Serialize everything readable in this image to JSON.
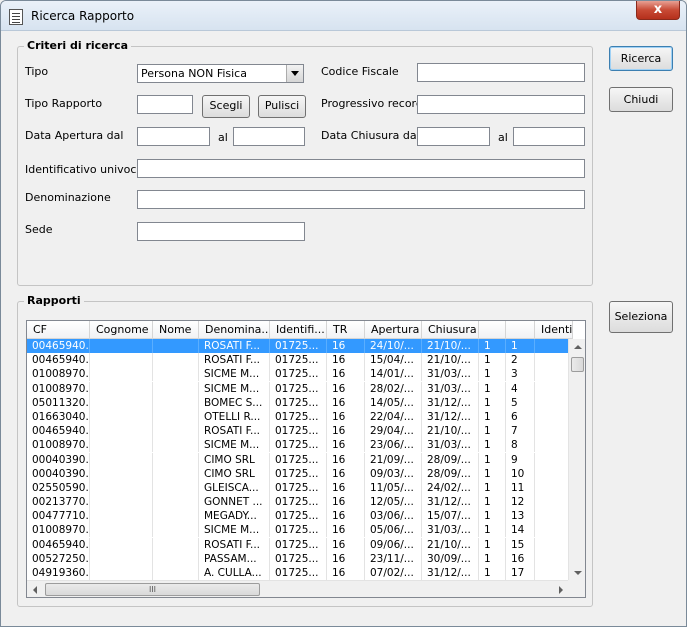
{
  "window": {
    "title": "Ricerca Rapporto",
    "close_glyph": "x"
  },
  "criteria": {
    "group_title": "Criteri di ricerca",
    "tipo_label": "Tipo",
    "tipo_value": "Persona NON Fisica",
    "codice_fiscale_label": "Codice Fiscale",
    "codice_fiscale_value": "",
    "tipo_rapporto_label": "Tipo Rapporto",
    "tipo_rapporto_value": "",
    "scegli_label": "Scegli",
    "pulisci_label": "Pulisci",
    "progressivo_label": "Progressivo record",
    "progressivo_value": "",
    "data_apertura_label": "Data Apertura dal",
    "data_apertura_dal": "",
    "al_label_1": "al",
    "data_apertura_al": "",
    "data_chiusura_label": "Data Chiusura dal",
    "data_chiusura_dal": "",
    "al_label_2": "al",
    "data_chiusura_al": "",
    "identificativo_label": "Identificativo univoco",
    "identificativo_value": "",
    "denominazione_label": "Denominazione",
    "denominazione_value": "",
    "sede_label": "Sede",
    "sede_value": ""
  },
  "buttons": {
    "ricerca": "Ricerca",
    "chiudi": "Chiudi",
    "seleziona": "Seleziona"
  },
  "rapporti": {
    "group_title": "Rapporti",
    "columns": [
      "CF",
      "Cognome",
      "Nome",
      "Denomina...",
      "Identifi...",
      "TR",
      "Apertura",
      "Chiusura",
      "",
      "",
      "Identif"
    ],
    "rows": [
      [
        "00465940...",
        "",
        "",
        "ROSATI F...",
        "01725...",
        "16",
        "24/10/...",
        "21/10/...",
        "1",
        "1"
      ],
      [
        "00465940...",
        "",
        "",
        "ROSATI F...",
        "01725...",
        "16",
        "15/04/...",
        "21/10/...",
        "1",
        "2"
      ],
      [
        "01008970...",
        "",
        "",
        "SICME M...",
        "01725...",
        "16",
        "14/01/...",
        "31/03/...",
        "1",
        "3"
      ],
      [
        "01008970...",
        "",
        "",
        "SICME M...",
        "01725...",
        "16",
        "28/02/...",
        "31/03/...",
        "1",
        "4"
      ],
      [
        "05011320...",
        "",
        "",
        "BOMEC S...",
        "01725...",
        "16",
        "14/05/...",
        "31/12/...",
        "1",
        "5"
      ],
      [
        "01663040...",
        "",
        "",
        "OTELLI R...",
        "01725...",
        "16",
        "22/04/...",
        "31/12/...",
        "1",
        "6"
      ],
      [
        "00465940...",
        "",
        "",
        "ROSATI F...",
        "01725...",
        "16",
        "29/04/...",
        "21/10/...",
        "1",
        "7"
      ],
      [
        "01008970...",
        "",
        "",
        "SICME M...",
        "01725...",
        "16",
        "23/06/...",
        "31/03/...",
        "1",
        "8"
      ],
      [
        "00040390...",
        "",
        "",
        "CIMO SRL",
        "01725...",
        "16",
        "21/09/...",
        "28/09/...",
        "1",
        "9"
      ],
      [
        "00040390...",
        "",
        "",
        "CIMO SRL",
        "01725...",
        "16",
        "09/03/...",
        "28/09/...",
        "1",
        "10"
      ],
      [
        "02550590...",
        "",
        "",
        "GLEISCA...",
        "01725...",
        "16",
        "11/05/...",
        "24/02/...",
        "1",
        "11"
      ],
      [
        "00213770...",
        "",
        "",
        "GONNET ...",
        "01725...",
        "16",
        "12/05/...",
        "31/12/...",
        "1",
        "12"
      ],
      [
        "00477710...",
        "",
        "",
        "MEGADY...",
        "01725...",
        "16",
        "03/06/...",
        "15/07/...",
        "1",
        "13"
      ],
      [
        "01008970...",
        "",
        "",
        "SICME M...",
        "01725...",
        "16",
        "05/06/...",
        "31/03/...",
        "1",
        "14"
      ],
      [
        "00465940...",
        "",
        "",
        "ROSATI F...",
        "01725...",
        "16",
        "09/06/...",
        "21/10/...",
        "1",
        "15"
      ],
      [
        "00527250...",
        "",
        "",
        "PASSAM...",
        "01725...",
        "16",
        "23/11/...",
        "30/09/...",
        "1",
        "16"
      ],
      [
        "04919360...",
        "",
        "",
        "A. CULLA...",
        "01725...",
        "16",
        "07/02/...",
        "31/12/...",
        "1",
        "17"
      ]
    ],
    "selected_row": 0,
    "hscroll_grip": "III"
  }
}
